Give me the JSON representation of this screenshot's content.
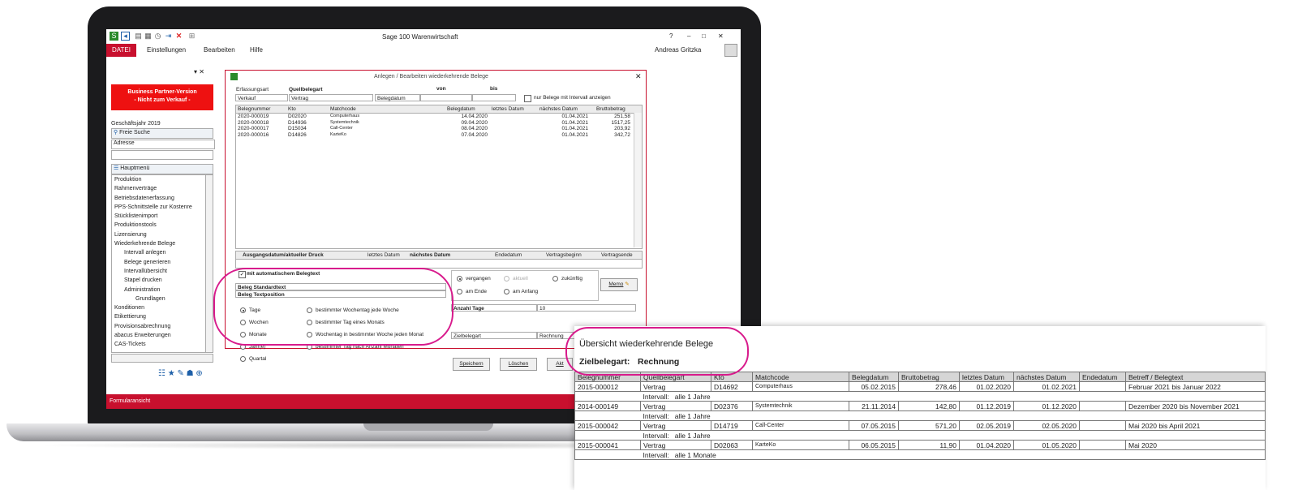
{
  "app": {
    "window_title": "Sage 100 Warenwirtschaft",
    "menu": [
      "DATEI",
      "Einstellungen",
      "Bearbeiten",
      "Hilfe"
    ],
    "user": "Andreas Gritzka",
    "window_controls": [
      "?",
      "–",
      "□",
      "✕"
    ],
    "statusbar": "Formularansicht"
  },
  "left_panel": {
    "banner_line1": "Business Partner-Version",
    "banner_line2": "- Nicht zum Verkauf -",
    "fiscal_year": "Geschäftsjahr 2019",
    "search_label": "Freie Suche",
    "search_select": "Adresse",
    "main_menu": "Hauptmenü",
    "tree": [
      "Produktion",
      "Rahmenverträge",
      "Betriebsdatenerfassung",
      "PPS-Schnittstelle zur Kostenre",
      "Stücklistenimport",
      "Produktionstools",
      "Lizensierung",
      "Wiederkehrende Belege",
      "Intervall anlegen",
      "Belege generieren",
      "Intervallübersicht",
      "Stapel drucken",
      "Administration",
      "Grundlagen",
      "Konditionen",
      "Etikettierung",
      "Provisionsabrechnung",
      "abacus Erweiterungen",
      "CAS-Tickets"
    ]
  },
  "dialog": {
    "title": "Anlegen / Bearbeiten wiederkehrende Belege",
    "erfassungsart_label": "Erfassungsart",
    "erfassungsart_value": "Verkauf",
    "quellbelegart_label": "Quellbelegart",
    "quellbelegart_value": "Vertrag",
    "von_label": "von",
    "bis_label": "bis",
    "belegdatum_label": "Belegdatum",
    "interval_only_label": "nur Belege mit Intervall anzeigen",
    "grid_headers": [
      "Belegnummer",
      "Kto",
      "Matchcode",
      "Belegdatum",
      "letztes Datum",
      "nächstes Datum",
      "Bruttobetrag"
    ],
    "grid_rows": [
      [
        "2020-000019",
        "D02020",
        "Computerhaus",
        "14.04.2020",
        "",
        "01.04.2021",
        "251,58"
      ],
      [
        "2020-000018",
        "D14936",
        "Systemtechnik",
        "09.04.2020",
        "",
        "01.04.2021",
        "1517,25"
      ],
      [
        "2020-000017",
        "D15034",
        "Call-Center",
        "08.04.2020",
        "",
        "01.04.2021",
        "203,92"
      ],
      [
        "2020-000016",
        "D14826",
        "KarteKo",
        "07.04.2020",
        "",
        "01.04.2021",
        "342,72"
      ]
    ],
    "grid2_headers": [
      "Ausgangsdatum/aktueller Druck",
      "letztes Datum",
      "nächstes Datum",
      "Endedatum",
      "Vertragsbeginn",
      "Vertragsende"
    ],
    "auto_text_label": "mit automatischem Belegtext",
    "beleg_standardtext": "Beleg Standardtext",
    "beleg_textposition": "Beleg Textposition",
    "time_options": [
      "vergangen",
      "aktuell",
      "zukünftig"
    ],
    "pos_options": [
      "am Ende",
      "am Anfang"
    ],
    "memo_button": "Memo",
    "interval_options_left": [
      "Tage",
      "Wochen",
      "Monate",
      "Jahr(e)",
      "Quartal"
    ],
    "interval_options_right": [
      "bestimmter Wochentag jede Woche",
      "bestimmter Tag eines Monats",
      "Wochentag in bestimmter Woche jeden Monat",
      "bestimmter Tag nach Anzahl Monaten"
    ],
    "anzahl_tage_label": "Anzahl Tage",
    "anzahl_tage_value": "10",
    "zielbelegart_label": "Zielbelegart",
    "zielbelegart_value": "Rechnung",
    "buttons": [
      "Speichern",
      "Löschen",
      "Akt"
    ]
  },
  "report": {
    "title": "Übersicht wiederkehrende Belege",
    "ziel_label": "Zielbelegart:",
    "ziel_value": "Rechnung",
    "headers": [
      "Belegnummer",
      "Quellbelegart",
      "Kto",
      "Matchcode",
      "Belegdatum",
      "Bruttobetrag",
      "letztes Datum",
      "nächstes Datum",
      "Endedatum",
      "Betreff / Belegtext"
    ],
    "rows": [
      {
        "cells": [
          "2015-000012",
          "Vertrag",
          "D14692",
          "Computerhaus",
          "05.02.2015",
          "278,46",
          "01.02.2020",
          "01.02.2021",
          "",
          "Februar 2021 bis Januar 2022"
        ],
        "interval": "Intervall:   alle 1 Jahre"
      },
      {
        "cells": [
          "2014-000149",
          "Vertrag",
          "D02376",
          "Systemtechnik",
          "21.11.2014",
          "142,80",
          "01.12.2019",
          "01.12.2020",
          "",
          "Dezember 2020 bis November 2021"
        ],
        "interval": "Intervall:   alle 1 Jahre"
      },
      {
        "cells": [
          "2015-000042",
          "Vertrag",
          "D14719",
          "Call-Center",
          "07.05.2015",
          "571,20",
          "02.05.2019",
          "02.05.2020",
          "",
          "Mai 2020 bis April 2021"
        ],
        "interval": "Intervall:   alle 1 Jahre"
      },
      {
        "cells": [
          "2015-000041",
          "Vertrag",
          "D02063",
          "KarteKo",
          "06.05.2015",
          "11,90",
          "01.04.2020",
          "01.05.2020",
          "",
          "Mai 2020"
        ],
        "interval": "Intervall:   alle 1 Monate"
      }
    ]
  },
  "colors": {
    "accent": "#c8102e",
    "highlight": "#d81b8c",
    "banner": "#ee1111"
  }
}
